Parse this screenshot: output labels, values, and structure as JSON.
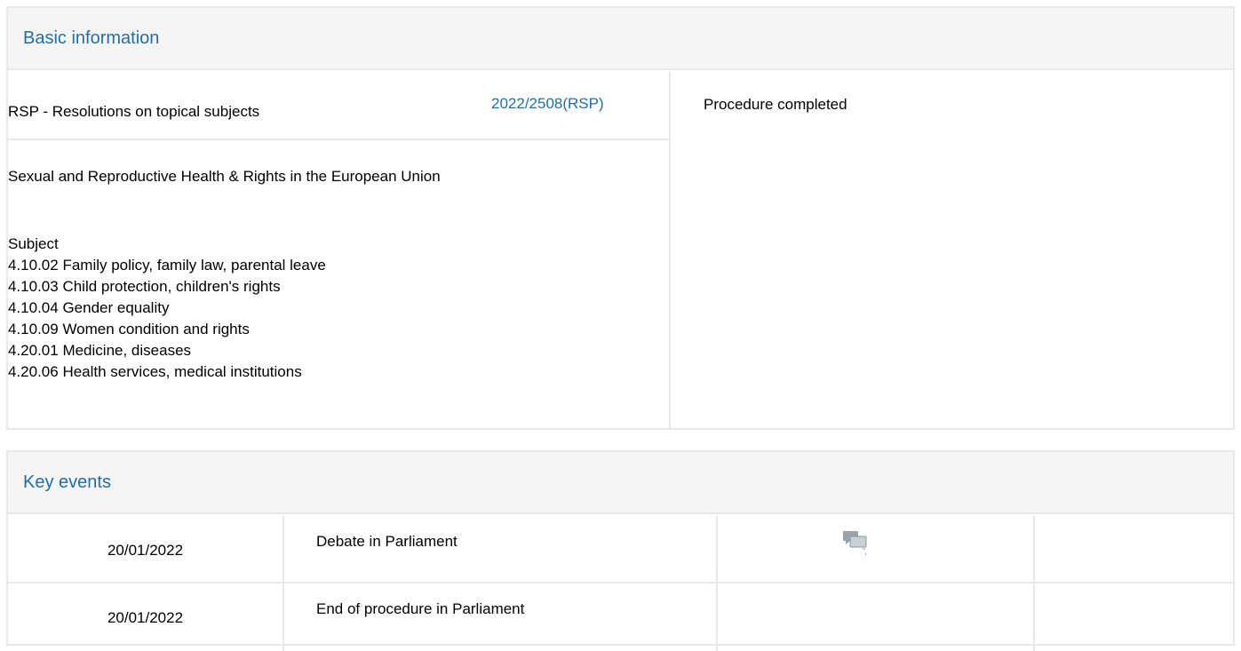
{
  "basic_information": {
    "heading": "Basic information",
    "procedure_type": "RSP - Resolutions on topical subjects",
    "procedure_reference": "2022/2508(RSP)",
    "status": "Procedure completed",
    "title": "Sexual and Reproductive Health & Rights in the European Union",
    "subject_heading": "Subject",
    "subjects": [
      "4.10.02 Family policy, family law, parental leave",
      "4.10.03 Child protection, children's rights",
      "4.10.04 Gender equality",
      "4.10.09 Women condition and rights",
      "4.20.01 Medicine, diseases",
      "4.20.06 Health services, medical institutions"
    ]
  },
  "key_events": {
    "heading": "Key events",
    "rows": [
      {
        "date": "20/01/2022",
        "event": "Debate in Parliament",
        "icon": "debate-speech-bubbles-icon"
      },
      {
        "date": "20/01/2022",
        "event": "End of procedure in Parliament"
      }
    ]
  },
  "colors": {
    "accent": "#1f6ea7",
    "header_bg": "#f5f5f5",
    "border": "#e8e8e8"
  }
}
